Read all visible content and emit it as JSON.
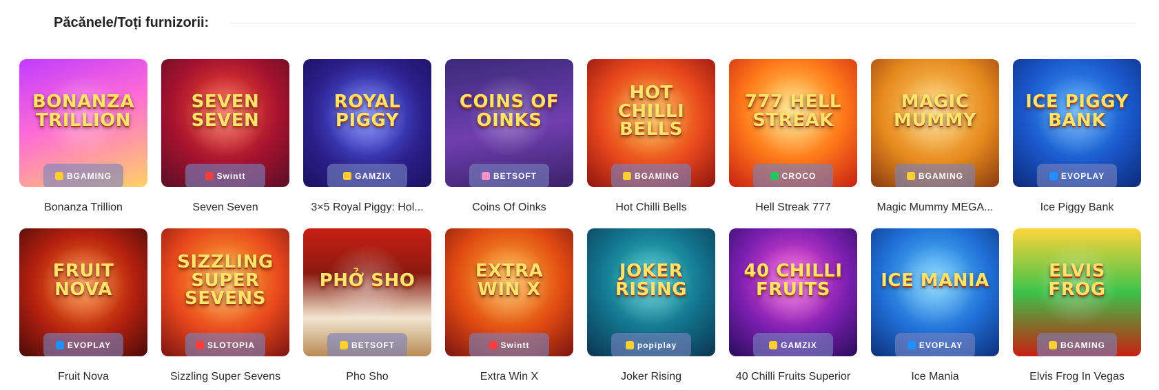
{
  "header": {
    "title": "Păcănele/Toți furnizorii:"
  },
  "games": [
    {
      "name": "Bonanza Trillion",
      "art": "Bonanza Trillion",
      "provider": "BGAMING",
      "provider_icon": "bgaming-logo",
      "bg": "linear-gradient(160deg,#c13cff 0%,#ff6bd6 45%,#ffd166 100%)",
      "accent": "#ffcf2e"
    },
    {
      "name": "Seven Seven",
      "art": "Seven Seven",
      "provider": "Swintt",
      "provider_icon": "swintt-logo",
      "bg": "radial-gradient(circle at 50% 40%,#ff4d2e 0%,#a3122f 55%,#5a0f24 100%)",
      "accent": "#ff3d3d"
    },
    {
      "name": "3×5 Royal Piggy: Hol...",
      "art": "Royal Piggy",
      "provider": "GAMZIX",
      "provider_icon": "gamzix-logo",
      "bg": "radial-gradient(circle at 50% 45%,#5b6bff 0%,#2b1f8a 60%,#1a1260 100%)",
      "accent": "#ffcb2e"
    },
    {
      "name": "Coins Of Oinks",
      "art": "Coins of Oinks",
      "provider": "BETSOFT",
      "provider_icon": "betsoft-logo",
      "bg": "linear-gradient(170deg,#3b2a7a 0%,#6f3fb0 55%,#3a2168 100%)",
      "accent": "#ff8fc8"
    },
    {
      "name": "Hot Chilli Bells",
      "art": "Hot Chilli Bells",
      "provider": "BGAMING",
      "provider_icon": "bgaming-logo",
      "bg": "radial-gradient(circle at 50% 45%,#ffb12e 0%,#e8471d 55%,#8f140f 100%)",
      "accent": "#ffcf2e"
    },
    {
      "name": "Hell Streak 777",
      "art": "777 Hell Streak",
      "provider": "CROCO",
      "provider_icon": "croco-logo",
      "bg": "radial-gradient(circle at 50% 40%,#ffe16b 0%,#ff7a1a 50%,#c81f12 100%)",
      "accent": "#22c55e"
    },
    {
      "name": "Magic Mummy MEGA...",
      "art": "Magic Mummy",
      "provider": "BGAMING",
      "provider_icon": "bgaming-logo",
      "bg": "radial-gradient(circle at 50% 40%,#ffd36b 0%,#e6891d 55%,#8a3a10 100%)",
      "accent": "#ffcf2e"
    },
    {
      "name": "Ice Piggy Bank",
      "art": "Ice Piggy Bank",
      "provider": "EVOPLAY",
      "provider_icon": "evoplay-logo",
      "bg": "radial-gradient(circle at 50% 40%,#3aa0ff 0%,#1a56c9 55%,#0c2a78 100%)",
      "accent": "#1e90ff"
    },
    {
      "name": "Fruit Nova",
      "art": "Fruit Nova",
      "provider": "EVOPLAY",
      "provider_icon": "evoplay-logo",
      "bg": "radial-gradient(circle at 50% 45%,#ff7a1a 0%,#b3200f 55%,#4a0a0a 100%)",
      "accent": "#1e90ff"
    },
    {
      "name": "Sizzling Super Sevens",
      "art": "Sizzling Super Sevens",
      "provider": "SLOTOPIA",
      "provider_icon": "slotopia-logo",
      "bg": "radial-gradient(circle at 50% 40%,#ffb12e 0%,#e8471d 55%,#7a1410 100%)",
      "accent": "#ff3d3d"
    },
    {
      "name": "Pho Sho",
      "art": "Phở Sho",
      "provider": "BETSOFT",
      "provider_icon": "betsoft-logo",
      "bg": "linear-gradient(180deg,#c81f12 0%,#8a1a10 35%,#f2e6d0 70%,#b98a55 100%)",
      "accent": "#ffcf2e"
    },
    {
      "name": "Extra Win X",
      "art": "Extra Win X",
      "provider": "Swintt",
      "provider_icon": "swintt-logo",
      "bg": "radial-gradient(circle at 50% 40%,#ffb12e 0%,#e04a12 55%,#7a1410 100%)",
      "accent": "#ff3d3d"
    },
    {
      "name": "Joker Rising",
      "art": "Joker Rising",
      "provider": "popiplay",
      "provider_icon": "popiplay-logo",
      "bg": "radial-gradient(circle at 50% 40%,#2fc4c9 0%,#12708a 55%,#0c3550 100%)",
      "accent": "#ffcf2e"
    },
    {
      "name": "40 Chilli Fruits Superior",
      "art": "40 Chilli Fruits",
      "provider": "GAMZIX",
      "provider_icon": "gamzix-logo",
      "bg": "radial-gradient(circle at 50% 40%,#ff4fd8 0%,#7a1fb0 55%,#2a0c5a 100%)",
      "accent": "#ffcf2e"
    },
    {
      "name": "Ice Mania",
      "art": "Ice Mania",
      "provider": "EVOPLAY",
      "provider_icon": "evoplay-logo",
      "bg": "radial-gradient(circle at 50% 40%,#5cc8ff 0%,#1f6fd6 55%,#0e2f7a 100%)",
      "accent": "#1e90ff"
    },
    {
      "name": "Elvis Frog In Vegas",
      "art": "Elvis Frog",
      "provider": "BGAMING",
      "provider_icon": "bgaming-logo",
      "bg": "linear-gradient(180deg,#ffd43b 0%,#3cc24a 50%,#c81f12 100%)",
      "accent": "#ffcf2e"
    }
  ]
}
